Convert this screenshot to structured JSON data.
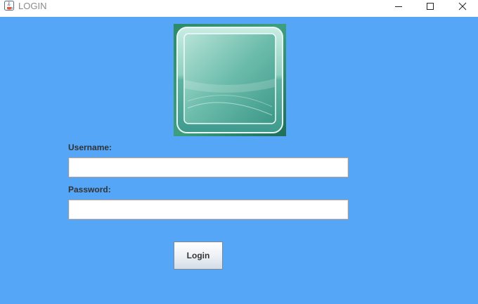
{
  "window": {
    "title": "LOGIN",
    "icons": {
      "app": "java-cup-icon",
      "minimize": "minimize-icon",
      "maximize": "maximize-icon",
      "close": "close-icon"
    },
    "background_color": "#55a6f6"
  },
  "logo": {
    "icon": "glass-square-logo",
    "colors": [
      "#2f8f6e",
      "#7cc7b3",
      "#c8ece2"
    ]
  },
  "form": {
    "username_label": "Username:",
    "username_value": "",
    "password_label": "Password:",
    "password_value": "",
    "login_button": "Login"
  }
}
